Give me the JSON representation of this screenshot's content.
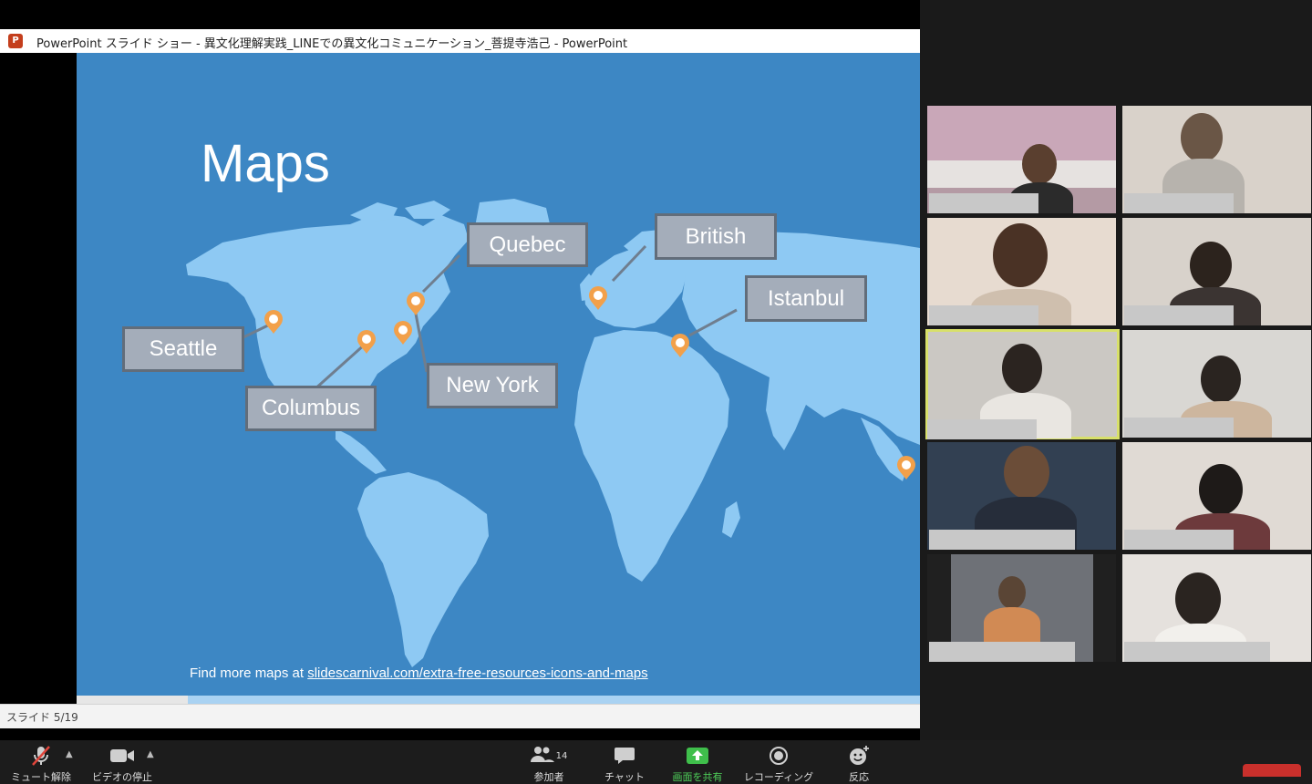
{
  "ppt": {
    "window_title": "PowerPoint スライド ショー  -  異文化理解実践_LINEでの異文化コミュニケーション_菩提寺浩己  -  PowerPoint",
    "logo_letter": "P",
    "slide_status": "スライド 5/19",
    "slide_current": 5,
    "slide_total": 19
  },
  "slide": {
    "title": "Maps",
    "labels": {
      "quebec": "Quebec",
      "british": "British",
      "istanbul": "Istanbul",
      "seattle": "Seattle",
      "columbus": "Columbus",
      "new_york": "New York"
    },
    "footer_prefix": "Find more maps at ",
    "footer_link": "slidescarnival.com/extra-free-resources-icons-and-maps",
    "colors": {
      "ocean": "#3d87c4",
      "land": "#8ec9f3",
      "pin": "#f2a04a",
      "label_bg": "#a4adba"
    }
  },
  "toolbar": {
    "mute_label": "ミュート解除",
    "video_label": "ビデオの停止",
    "participants_label": "参加者",
    "participants_count": "14",
    "chat_label": "チャット",
    "share_label": "画面を共有",
    "record_label": "レコーディング",
    "reaction_label": "反応"
  },
  "gallery": {
    "tile_count": 10,
    "active_tile": 5
  }
}
